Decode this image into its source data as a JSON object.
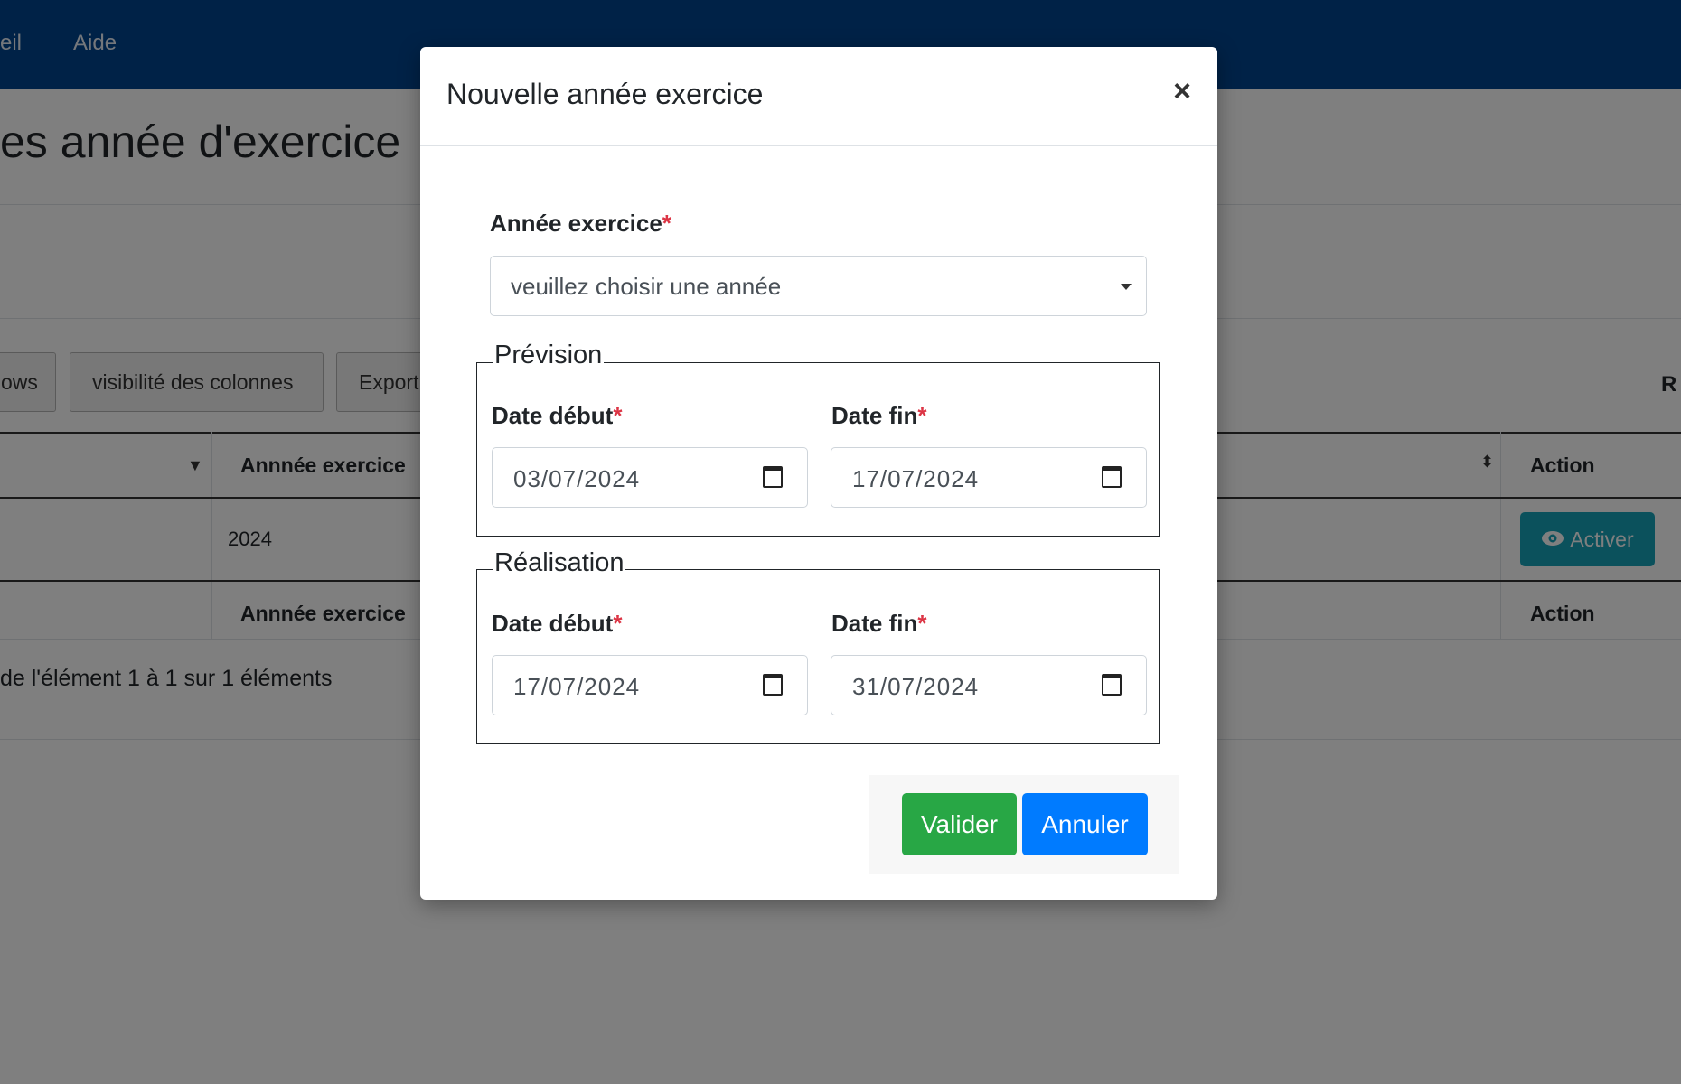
{
  "topnav": {
    "items": [
      "eil",
      "Aide"
    ]
  },
  "page": {
    "title": "es année d'exercice"
  },
  "toolbar": {
    "buttons": [
      "ows",
      "visibilité des colonnes",
      "Export"
    ],
    "search_label_cut": "R"
  },
  "table": {
    "headers": {
      "col1": "",
      "annee": "Annnée exercice",
      "action": "Action"
    },
    "rows": [
      {
        "annee": "2024",
        "action_label": "Activer"
      }
    ],
    "footer_headers": {
      "annee": "Annnée exercice",
      "action": "Action"
    },
    "info": "de l'élément 1 à 1 sur 1 éléments"
  },
  "modal": {
    "title": "Nouvelle année exercice",
    "close_glyph": "×",
    "annee_label": "Année exercice",
    "annee_placeholder": "veuillez choisir une année",
    "required_mark": "*",
    "prevision": {
      "legend": "Prévision",
      "debut_label": "Date début",
      "fin_label": "Date fin",
      "debut_value": "03/07/2024",
      "fin_value": "17/07/2024"
    },
    "realisation": {
      "legend": "Réalisation",
      "debut_label": "Date début",
      "fin_label": "Date fin",
      "debut_value": "17/07/2024",
      "fin_value": "31/07/2024"
    },
    "valider_label": "Valider",
    "annuler_label": "Annuler"
  },
  "colors": {
    "topbar": "#00458f",
    "valider": "#28a745",
    "annuler": "#007bff",
    "activer": "#17a2b8",
    "required": "#dc3545"
  }
}
